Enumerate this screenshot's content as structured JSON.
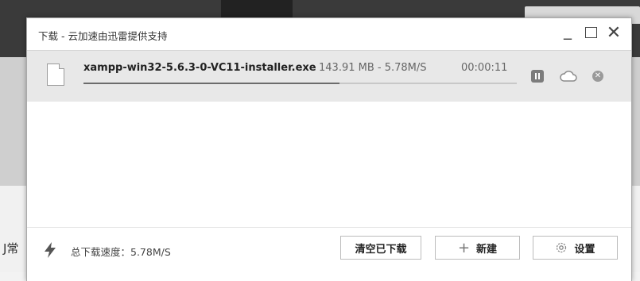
{
  "background": {
    "side_text": "J常"
  },
  "window": {
    "title": "下载 - 云加速由迅雷提供支持",
    "controls": {
      "minimize": "_",
      "close": "✕"
    }
  },
  "download": {
    "file_name": "xampp-win32-5.6.3-0-VC11-installer.exe",
    "size_speed": "143.91 MB - 5.78M/S",
    "time_remaining": "00:00:11",
    "progress_percent": 59
  },
  "footer": {
    "total_speed": "总下载速度：5.78M/S",
    "clear_label": "清空已下载",
    "new_plus": "+",
    "new_label": "新建",
    "settings_label": "设置"
  },
  "icons": [
    "file-icon",
    "pause-icon",
    "cloud-icon",
    "cancel-icon",
    "lightning-icon",
    "plus-icon",
    "gear-icon"
  ],
  "colors": {
    "progress_fill": "#6c6c6c",
    "row_background": "#e8e8e8"
  }
}
